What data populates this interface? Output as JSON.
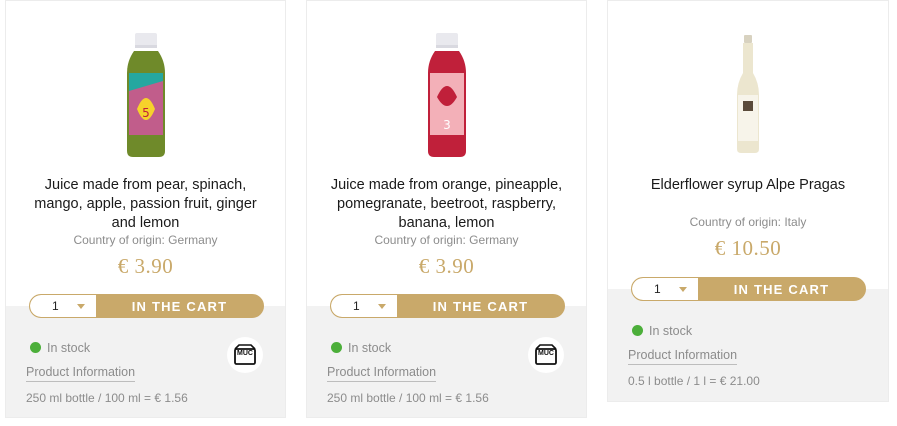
{
  "products": [
    {
      "title": "Juice made from pear, spinach, mango, apple, passion fruit, ginger and lemon",
      "origin": "Country of origin: Germany",
      "price": "€ 3.90",
      "quantity": "1",
      "cart_label": "IN THE CART",
      "stock": "In stock",
      "info_link": "Product Information",
      "base_price": "250 ml bottle / 100 ml = € 1.56",
      "badge_label": "MUC",
      "bottle_color": "#6f8a2a"
    },
    {
      "title": "Juice made from orange, pineapple, pomegranate, beetroot, raspberry, banana, lemon",
      "origin": "Country of origin: Germany",
      "price": "€ 3.90",
      "quantity": "1",
      "cart_label": "IN THE CART",
      "stock": "In stock",
      "info_link": "Product Information",
      "base_price": "250 ml bottle / 100 ml = € 1.56",
      "badge_label": "MUC",
      "bottle_color": "#c0203a"
    },
    {
      "title": "Elderflower syrup Alpe Pragas",
      "origin": "Country of origin: Italy",
      "price": "€ 10.50",
      "quantity": "1",
      "cart_label": "IN THE CART",
      "stock": "In stock",
      "info_link": "Product Information",
      "base_price": "0.5 l bottle / 1 l = € 21.00"
    }
  ],
  "colors": {
    "accent": "#c9a96a",
    "in_stock": "#4caf3a",
    "muted_text": "#8c8c8c",
    "footer_bg": "#f2f2f2"
  }
}
